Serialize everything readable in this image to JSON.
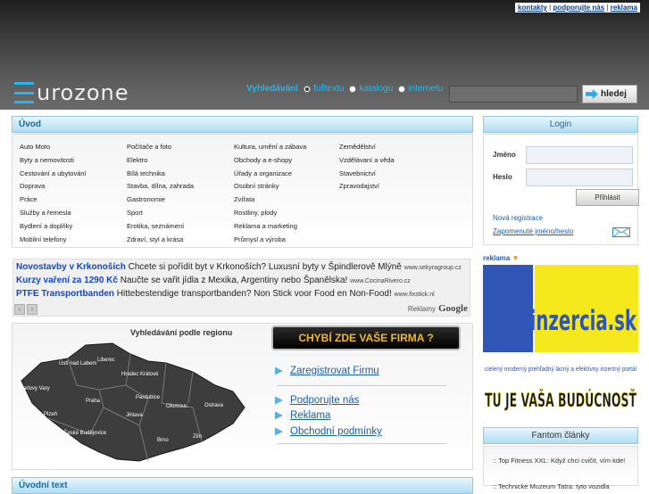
{
  "header": {
    "links": [
      "kontakty",
      "podporujte nás",
      "reklama"
    ],
    "separator": "|",
    "logo_text": "urozone",
    "search_label": "Vyhledávání",
    "search_options": [
      "fulltextu",
      "katalogu",
      "internetu"
    ],
    "search_value": "",
    "search_button": "hledej"
  },
  "uvod": {
    "title": "Úvod",
    "categories": [
      [
        "Auto Moto",
        "Byty a nemovitosti",
        "Cestování a ubytování",
        "Doprava",
        "Práce",
        "Služby a řemesla",
        "Bydlení a doplňky",
        "Mobilní telefony"
      ],
      [
        "Počítače a foto",
        "Elektro",
        "Bílá technika",
        "Stavba, dílna, zahrada",
        "Gastronomie",
        "Sport",
        "Erotika, seznámení",
        "Zdraví, styl a krása"
      ],
      [
        "Kultura, umění a zábava",
        "Obchody a e-shopy",
        "Úřady a organizace",
        "Osobní stránky",
        "Zvířata",
        "Rostliny, plody",
        "Reklama a marketing",
        "Průmysl a výroba"
      ],
      [
        "Zemědělství",
        "Vzdělávaní a věda",
        "Stavebnictví",
        "Zpravodajství"
      ]
    ]
  },
  "ads": {
    "items": [
      {
        "title": "Novostavby v Krkonoších",
        "text": "Chcete si pořídit byt v Krkonoších? Luxusní byty v Špindlerově Mlýně",
        "domain": "www.sekyragroup.cz"
      },
      {
        "title": "Kurzy vaření za 1290 Kč",
        "text": "Naučte se vařit jídla z Mexika, Argentiny nebo Španělska!",
        "domain": "www.CocinaRivero.cz"
      },
      {
        "title": "PTFE Transportbanden",
        "text": "Hittebestendige transportbanden? Non Stick voor Food en Non-Food!",
        "domain": "www.fixstick.nl"
      }
    ],
    "footer_label": "Reklamy",
    "footer_brand": "Google"
  },
  "region": {
    "title": "Vyhledávání podle regionu",
    "cities": [
      "Liberec",
      "Ústí nad Labem",
      "Hradec Králové",
      "Karlovy Vary",
      "Praha",
      "Pardubice",
      "Plzeň",
      "Jihlava",
      "Olomouc",
      "Ostrava",
      "České Budějovice",
      "Brno",
      "Zlín"
    ]
  },
  "promo": {
    "banner": "CHYBÍ  ZDE VAŠE FIRMA ?",
    "links": [
      "Zaregistrovat Firmu",
      "Podporujte nás",
      "Reklama",
      "Obchodní podmínky"
    ]
  },
  "uvodtext": {
    "title": "Úvodní text"
  },
  "login": {
    "title": "Login",
    "name_label": "Jméno",
    "pass_label": "Heslo",
    "name_value": "",
    "pass_value": "",
    "submit": "Přihlásit",
    "register": "Nová registrace",
    "forgot": "Zapomenuté jméno/heslo"
  },
  "reklama": {
    "label": "reklama",
    "arrow": "▼",
    "banner_top": "euroinzercia.sk",
    "banner_mid": "cielený moderný prehľadný lacný a efektívny inzertný portál",
    "banner_bottom": "TU JE VAŠA BUDÚCNOSŤ"
  },
  "fantom": {
    "title": "Fantom články",
    "items": [
      "Top Fitness XXL: Když chci cvičit, vím kde!",
      "Technické Muzeum Tatra: tyto vozidla"
    ]
  },
  "colors": {
    "accent": "#21b7f0",
    "link": "#1a5fb4",
    "ad_title": "#1147c8",
    "promo_text": "#f0b823",
    "map_fill": "#3d3d3d"
  }
}
